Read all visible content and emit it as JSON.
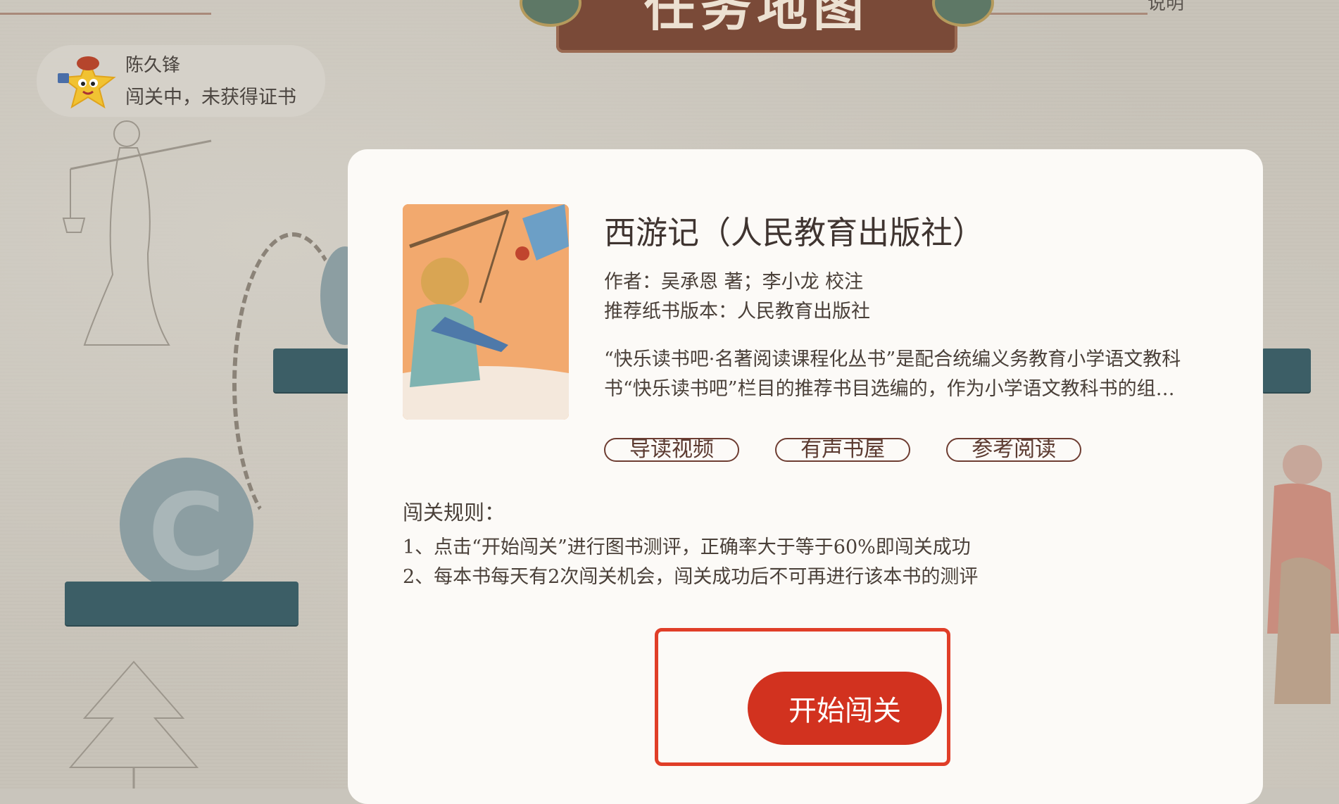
{
  "map": {
    "title": "任务地图",
    "top_right_text": "说明"
  },
  "user": {
    "name": "陈久锋",
    "status": "闯关中，未获得证书"
  },
  "book": {
    "title": "西游记（人民教育出版社）",
    "author_line": "作者：吴承恩 著；李小龙 校注",
    "edition_line": "推荐纸书版本：人民教育出版社",
    "description_lines": [
      "“快乐读书吧·名著阅读课程化丛书”是配合统编义务教育小学语文教科",
      "书“快乐读书吧”栏目的推荐书目选编的，作为小学语文教科书的组…"
    ],
    "actions": [
      "导读视频",
      "有声书屋",
      "参考阅读"
    ]
  },
  "rules": {
    "title": "闯关规则：",
    "items": [
      "1、点击“开始闯关”进行图书测评，正确率大于等于60%即闯关成功",
      "2、每本书每天有2次闯关机会，闯关成功后不可再进行该本书的测评"
    ]
  },
  "start_button": "开始闯关",
  "colors": {
    "accent_red": "#d2321f",
    "highlight_border": "#e03e28",
    "pill_border": "#6e3d32",
    "banner": "#7a4a38",
    "plank": "#3c5e66"
  }
}
